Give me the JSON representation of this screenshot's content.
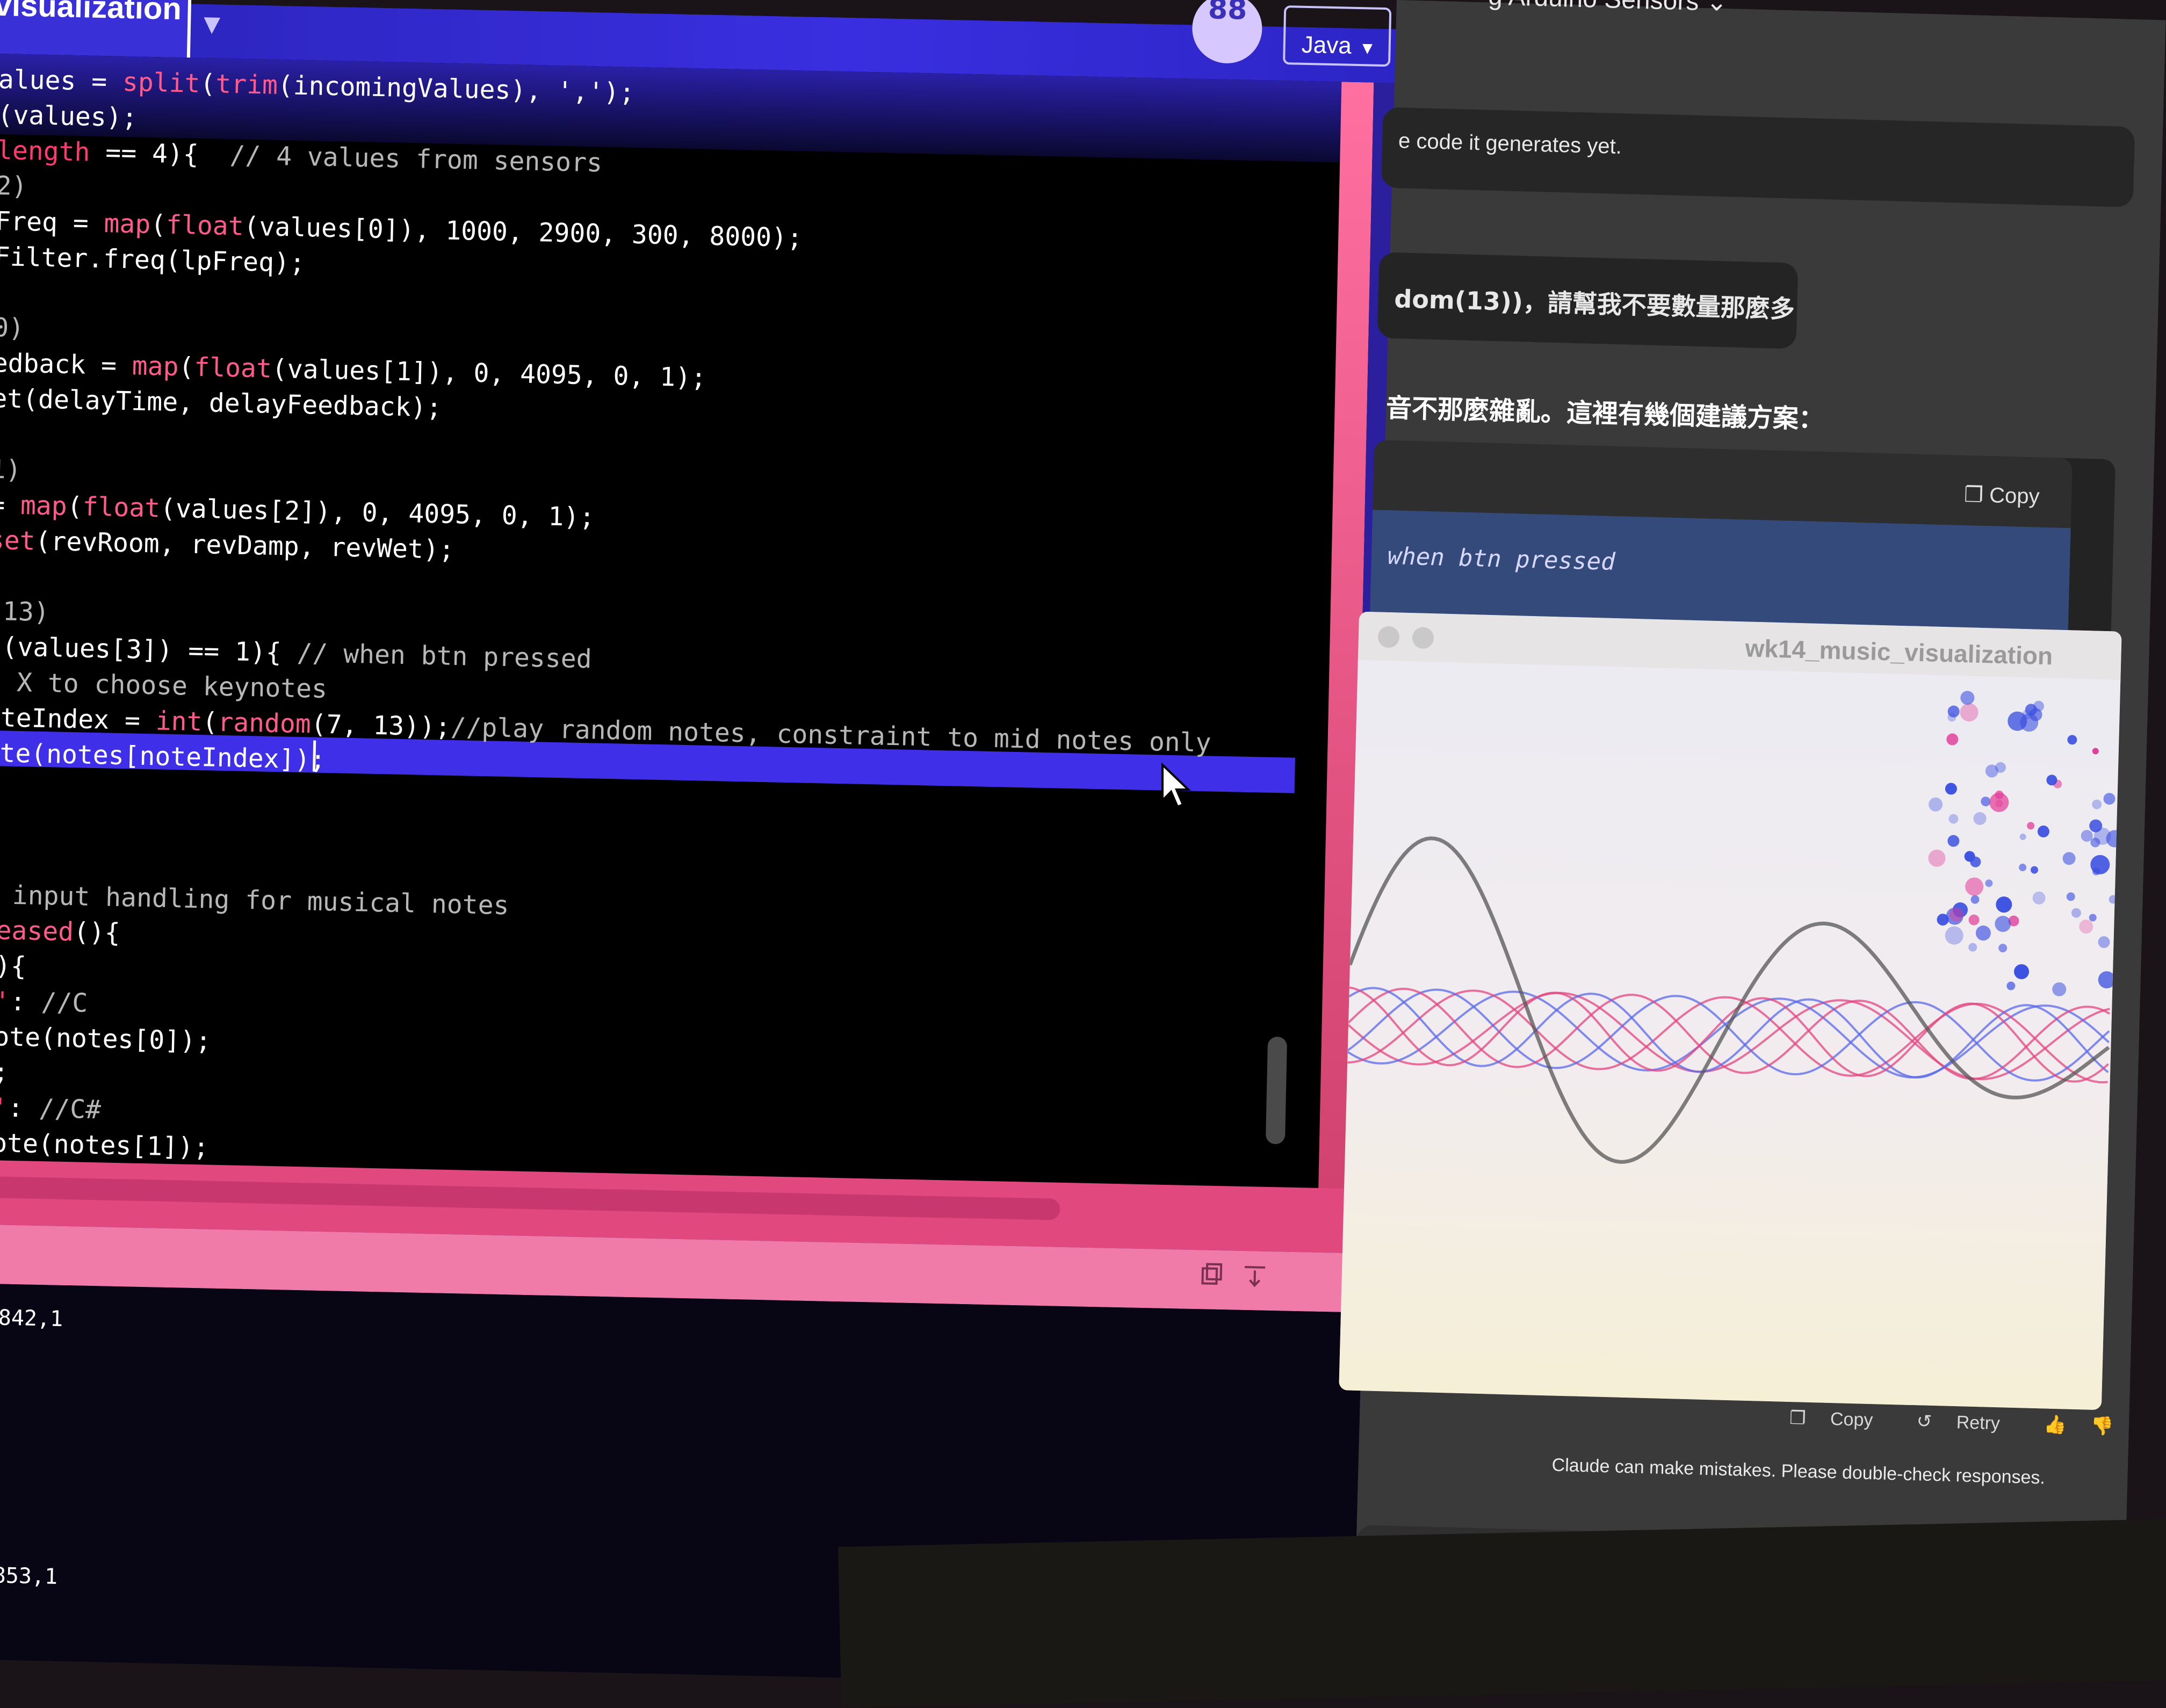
{
  "ide": {
    "tab_label": "visualization",
    "tab_arrow": "▼",
    "debug_glyph": "88",
    "mode": "Java",
    "mode_arrow": "▼"
  },
  "code": [
    [
      [
        "alues = ",
        "st"
      ],
      [
        "split",
        "fn"
      ],
      [
        "(",
        "st"
      ],
      [
        "trim",
        "fn"
      ],
      [
        "(incomingValues), ',');",
        "st"
      ]
    ],
    [
      [
        "(values);",
        "st"
      ]
    ],
    [
      [
        "length",
        "kw"
      ],
      [
        " == 4){  ",
        "st"
      ],
      [
        "// 4 values from sensors",
        "cm"
      ]
    ],
    [
      [
        "2)",
        "cm"
      ]
    ],
    [
      [
        "Freq = ",
        "st"
      ],
      [
        "map",
        "fn"
      ],
      [
        "(",
        "st"
      ],
      [
        "float",
        "fn"
      ],
      [
        "(values[0]), 1000, 2900, 300, 8000);",
        "st"
      ]
    ],
    [
      [
        "Filter.freq(lpFreq);",
        "st"
      ]
    ],
    [
      [
        "",
        "st"
      ]
    ],
    [
      [
        "0)",
        "cm"
      ]
    ],
    [
      [
        "edback = ",
        "st"
      ],
      [
        "map",
        "fn"
      ],
      [
        "(",
        "st"
      ],
      [
        "float",
        "fn"
      ],
      [
        "(values[1]), 0, 4095, 0, 1);",
        "st"
      ]
    ],
    [
      [
        "et(delayTime, delayFeedback);",
        "st"
      ]
    ],
    [
      [
        "",
        "st"
      ]
    ],
    [
      [
        "1)",
        "cm"
      ]
    ],
    [
      [
        "= ",
        "st"
      ],
      [
        "map",
        "fn"
      ],
      [
        "(",
        "st"
      ],
      [
        "float",
        "fn"
      ],
      [
        "(values[2]), 0, 4095, 0, 1);",
        "st"
      ]
    ],
    [
      [
        "set",
        "fn"
      ],
      [
        "(revRoom, revDamp, revWet);",
        "st"
      ]
    ],
    [
      [
        "",
        "st"
      ]
    ],
    [
      [
        "(13)",
        "cm"
      ]
    ],
    [
      [
        "t(values[3]) == 1){ ",
        "st"
      ],
      [
        "// when btn pressed",
        "cm"
      ]
    ],
    [
      [
        "e X to choose keynotes",
        "cm"
      ]
    ],
    [
      [
        "oteIndex = ",
        "st"
      ],
      [
        "int",
        "fn"
      ],
      [
        "(",
        "st"
      ],
      [
        "random",
        "fn"
      ],
      [
        "(7, 13));",
        "st"
      ],
      [
        "//play random notes, constraint to mid notes only",
        "cm"
      ]
    ],
    [
      [
        "ote(notes[noteIndex]);",
        "st"
      ]
    ],
    [
      [
        "",
        "st"
      ]
    ],
    [
      [
        "",
        "st"
      ]
    ],
    [
      [
        "",
        "st"
      ]
    ],
    [
      [
        "d input handling for musical notes",
        "cm"
      ]
    ],
    [
      [
        "leased",
        "fn"
      ],
      [
        "(){",
        "st"
      ]
    ],
    [
      [
        "y",
        "kw"
      ],
      [
        "){",
        "st"
      ]
    ],
    [
      [
        "a'",
        "kw"
      ],
      [
        ": ",
        "st"
      ],
      [
        "//C",
        "cm"
      ]
    ],
    [
      [
        "Note(notes[0]);",
        "st"
      ]
    ],
    [
      [
        "k",
        "kw"
      ],
      [
        ";",
        "st"
      ]
    ],
    [
      [
        "w'",
        "kw"
      ],
      [
        ": ",
        "st"
      ],
      [
        "//C#",
        "cm"
      ]
    ],
    [
      [
        "Note(notes[1]);",
        "st"
      ]
    ],
    [
      [
        "k",
        "kw"
      ],
      [
        ";",
        "st"
      ]
    ],
    [
      [
        "s'",
        "kw"
      ],
      [
        ": ",
        "st"
      ],
      [
        "//D",
        "cm"
      ]
    ],
    [
      [
        "Note(notes[2]);",
        "st"
      ]
    ]
  ],
  "console": [
    ",1842,1",
    "'",
    "'",
    "'",
    "",
    "",
    ",1853,1",
    "'",
    "'"
  ],
  "chat": {
    "title": "g Arduino Sensors",
    "title_chevron": "⌄",
    "msg1": "e code it generates yet.",
    "msg2": "dom(13))，請幫我不要數量那麼多",
    "reply": "音不那麼雜亂。這裡有幾個建議方案：",
    "code_copy": "Copy",
    "code_line": "when btn pressed",
    "sketch_title": "wk14_music_visualization",
    "actions": {
      "copy": "Copy",
      "retry": "Retry"
    },
    "disclaimer": "Claude can make mistakes. Please double-check responses."
  },
  "colors": {
    "wave_pink": "#e2457f",
    "wave_blue": "#5a6ae8",
    "wave_dark": "#555555",
    "particle_blue": "#3a4fe0",
    "particle_pink": "#e23f9a"
  },
  "icons": [
    "copy-icon",
    "clear-console-icon",
    "retry-icon",
    "thumbs-up-icon",
    "thumbs-down-icon",
    "attach-icon",
    "mouse-cursor-icon"
  ]
}
